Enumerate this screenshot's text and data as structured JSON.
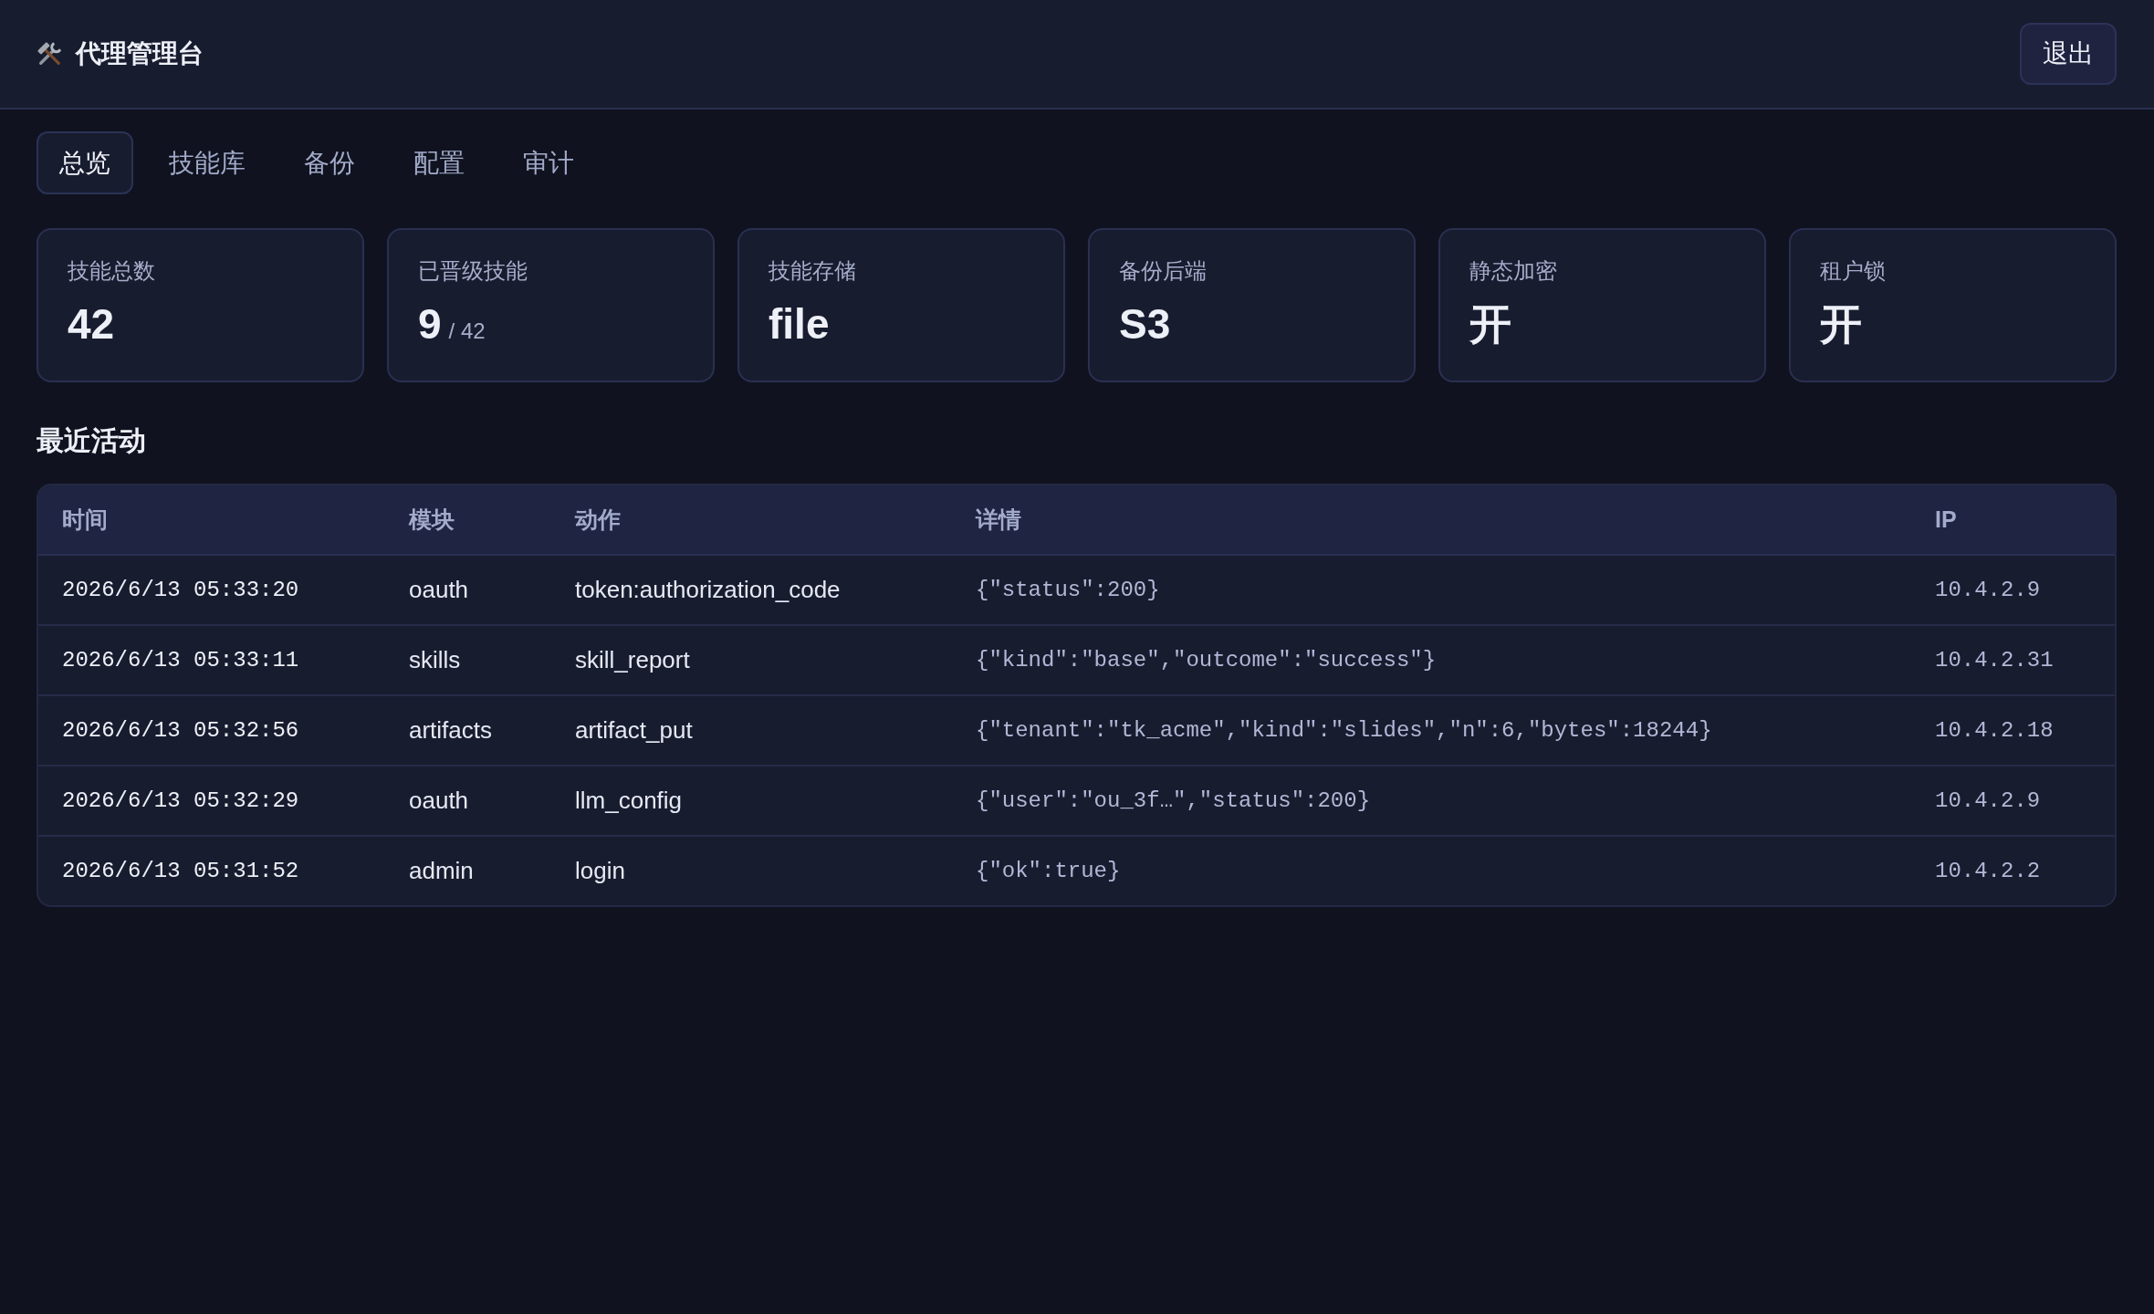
{
  "header": {
    "title": "代理管理台",
    "logout_button": "退出"
  },
  "tabs": [
    {
      "label": "总览",
      "selected": true
    },
    {
      "label": "技能库",
      "selected": false
    },
    {
      "label": "备份",
      "selected": false
    },
    {
      "label": "配置",
      "selected": false
    },
    {
      "label": "审计",
      "selected": false
    }
  ],
  "stats": [
    {
      "label": "技能总数",
      "value": "42"
    },
    {
      "label": "已晋级技能",
      "value": "9",
      "total": "/ 42"
    },
    {
      "label": "技能存储",
      "value": "file"
    },
    {
      "label": "备份后端",
      "value": "S3"
    },
    {
      "label": "静态加密",
      "value": "开"
    },
    {
      "label": "租户锁",
      "value": "开"
    }
  ],
  "recent_activity": {
    "title": "最近活动",
    "columns": [
      "时间",
      "模块",
      "动作",
      "详情",
      "IP"
    ],
    "rows": [
      {
        "time": "2026/6/13 05:33:20",
        "module": "oauth",
        "action": "token:authorization_code",
        "details": "{\"status\":200}",
        "ip": "10.4.2.9"
      },
      {
        "time": "2026/6/13 05:33:11",
        "module": "skills",
        "action": "skill_report",
        "details": "{\"kind\":\"base\",\"outcome\":\"success\"}",
        "ip": "10.4.2.31"
      },
      {
        "time": "2026/6/13 05:32:56",
        "module": "artifacts",
        "action": "artifact_put",
        "details": "{\"tenant\":\"tk_acme\",\"kind\":\"slides\",\"n\":6,\"bytes\":18244}",
        "ip": "10.4.2.18"
      },
      {
        "time": "2026/6/13 05:32:29",
        "module": "oauth",
        "action": "llm_config",
        "details": "{\"user\":\"ou_3f…\",\"status\":200}",
        "ip": "10.4.2.9"
      },
      {
        "time": "2026/6/13 05:31:52",
        "module": "admin",
        "action": "login",
        "details": "{\"ok\":true}",
        "ip": "10.4.2.2"
      }
    ]
  }
}
